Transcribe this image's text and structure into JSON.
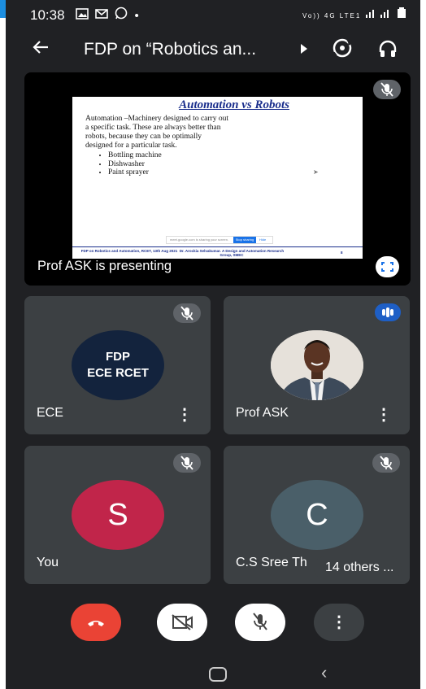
{
  "status_bar": {
    "time": "10:38",
    "notif_icons": "image-icon mail-icon whatsapp-icon dot",
    "right_text": "Vo)) 4G LTE1"
  },
  "top_bar": {
    "title": "FDP on “Robotics an...",
    "icons": [
      "back-arrow-icon",
      "play-triangle-icon",
      "switch-camera-icon",
      "headphones-icon"
    ]
  },
  "presentation": {
    "presenting_label": "Prof ASK is presenting",
    "slide": {
      "title": "Automation vs Robots",
      "body": "Automation –Machinery designed to carry out a specific task. These are always better than robots, because they can be optimally designed for a particular task.",
      "bullets": [
        "Bottling machine",
        "Dishwasher",
        "Paint sprayer"
      ],
      "share_bar_text": "meet.google.com is sharing your screen.",
      "stop_sharing": "Stop sharing",
      "hide": "Hide",
      "footer_left": "FDP on Robotics and Automation, RCET, 13th Aug 2021",
      "footer_center": "Dr. Arockia Selvakumar. A Design and Automation Research Group, SMEC",
      "footer_page": "8"
    }
  },
  "tiles": [
    {
      "name": "ECE",
      "avatar_line1": "FDP",
      "avatar_line2": "ECE RCET",
      "muted": true
    },
    {
      "name": "Prof ASK",
      "speaking": true
    },
    {
      "name": "You",
      "initial": "S",
      "muted": true
    },
    {
      "name": "C.S Sree Th",
      "initial": "C",
      "muted": true,
      "others_label": "14 others"
    }
  ],
  "controls": [
    "end-call",
    "camera-off",
    "mic-off",
    "more-options"
  ],
  "colors": {
    "end_call": "#ea4335",
    "speaking": "#1e5fc6",
    "tile": "#3c4043",
    "background": "#202124"
  }
}
